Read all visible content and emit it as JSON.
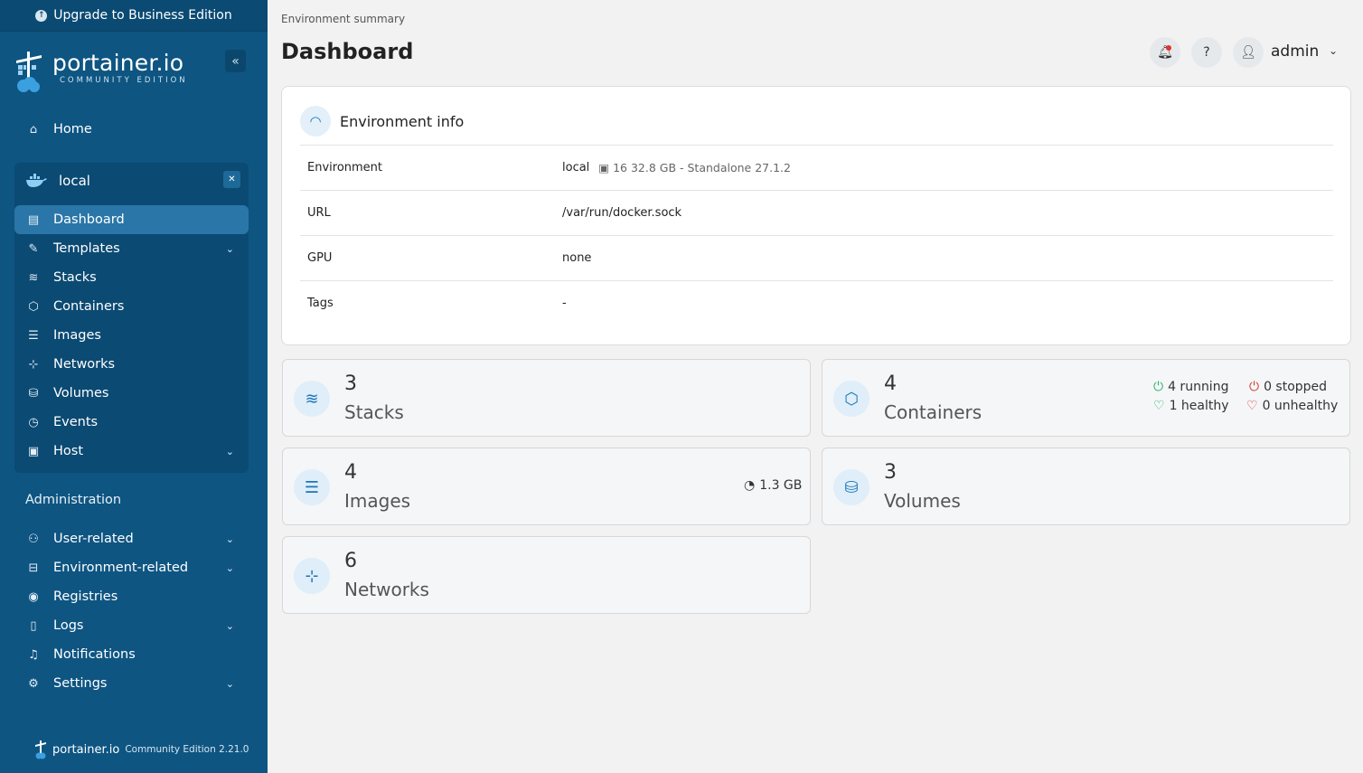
{
  "sidebar": {
    "upgrade_label": "Upgrade to Business Edition",
    "logo_main": "portainer.io",
    "logo_sub": "COMMUNITY EDITION",
    "home_label": "Home",
    "environment_name": "local",
    "env_items": [
      {
        "label": "Dashboard"
      },
      {
        "label": "Templates"
      },
      {
        "label": "Stacks"
      },
      {
        "label": "Containers"
      },
      {
        "label": "Images"
      },
      {
        "label": "Networks"
      },
      {
        "label": "Volumes"
      },
      {
        "label": "Events"
      },
      {
        "label": "Host"
      }
    ],
    "admin_section_label": "Administration",
    "admin_items": [
      {
        "label": "User-related"
      },
      {
        "label": "Environment-related"
      },
      {
        "label": "Registries"
      },
      {
        "label": "Logs"
      },
      {
        "label": "Notifications"
      },
      {
        "label": "Settings"
      }
    ],
    "footer_brand": "portainer.io",
    "footer_edition": "Community Edition 2.21.0"
  },
  "header": {
    "breadcrumb": "Environment summary",
    "title": "Dashboard",
    "user_name": "admin"
  },
  "environment_info": {
    "title": "Environment info",
    "rows": [
      {
        "key": "Environment",
        "value": "local",
        "meta": "16   32.8 GB - Standalone 27.1.2"
      },
      {
        "key": "URL",
        "value": "/var/run/docker.sock"
      },
      {
        "key": "GPU",
        "value": "none"
      },
      {
        "key": "Tags",
        "value": "-"
      }
    ]
  },
  "stats": {
    "stacks": {
      "count": "3",
      "label": "Stacks"
    },
    "containers": {
      "count": "4",
      "label": "Containers",
      "running": "4 running",
      "stopped": "0 stopped",
      "healthy": "1 healthy",
      "unhealthy": "0 unhealthy"
    },
    "images": {
      "count": "4",
      "label": "Images",
      "size": "1.3 GB"
    },
    "volumes": {
      "count": "3",
      "label": "Volumes"
    },
    "networks": {
      "count": "6",
      "label": "Networks"
    }
  },
  "colors": {
    "sidebar_bg": "#0e5582",
    "accent": "#1a75b8",
    "healthy": "#2fb36b",
    "unhealthy": "#d13c30"
  }
}
